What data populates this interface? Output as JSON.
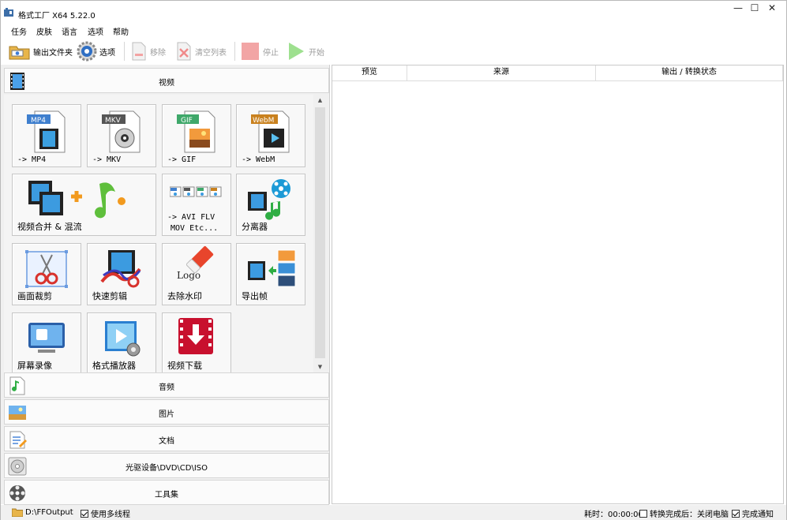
{
  "window": {
    "title": "格式工厂 X64 5.22.0",
    "controls": {
      "minimize": "—",
      "maximize": "☐",
      "close": "✕"
    }
  },
  "menu": [
    "任务",
    "皮肤",
    "语言",
    "选项",
    "帮助"
  ],
  "toolbar": {
    "output_folder": "输出文件夹",
    "options": "选项",
    "remove": "移除",
    "clear_list": "清空列表",
    "stop": "停止",
    "start": "开始"
  },
  "categories": {
    "video": "视频",
    "audio": "音频",
    "image": "图片",
    "document": "文档",
    "disc": "光驱设备\\DVD\\CD\\ISO",
    "tools": "工具集"
  },
  "tiles": {
    "mp4": {
      "label": "-> MP4",
      "badge": "MP4"
    },
    "mkv": {
      "label": "-> MKV",
      "badge": "MKV"
    },
    "gif": {
      "label": "-> GIF",
      "badge": "GIF"
    },
    "webm": {
      "label": "-> WebM",
      "badge": "WebM"
    },
    "merge": {
      "label": "视频合并 & 混流"
    },
    "avi": {
      "label_line1": "-> AVI FLV",
      "label_line2": "MOV Etc..."
    },
    "splitter": {
      "label": "分离器"
    },
    "crop": {
      "label": "画面裁剪"
    },
    "quick_cut": {
      "label": "快速剪辑"
    },
    "watermark": {
      "label": "去除水印",
      "logo_text": "Logo"
    },
    "export_frames": {
      "label": "导出帧"
    },
    "screen_record": {
      "label": "屏幕录像"
    },
    "player": {
      "label": "格式播放器"
    },
    "download": {
      "label": "视频下载"
    }
  },
  "task_table": {
    "columns": [
      "预览",
      "来源",
      "输出 / 转换状态"
    ]
  },
  "statusbar": {
    "output_path": "D:\\FFOutput",
    "multithread_label": "使用多线程",
    "multithread_checked": true,
    "elapsed": "耗时：00:00:00",
    "shutdown_label": "转换完成后：关闭电脑",
    "shutdown_checked": false,
    "notify_label": "完成通知",
    "notify_checked": true
  },
  "colors": {
    "start_green": "#5cc84a",
    "stop_red": "#f08080",
    "accent_blue": "#2f7fd8"
  }
}
